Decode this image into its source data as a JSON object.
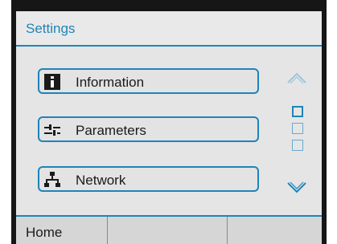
{
  "screen": {
    "title": "Settings"
  },
  "menu": {
    "items": [
      {
        "label": "Information",
        "icon": "info-icon"
      },
      {
        "label": "Parameters",
        "icon": "parameters-icon"
      },
      {
        "label": "Network",
        "icon": "network-icon"
      }
    ]
  },
  "pager": {
    "current_page": 1,
    "total_pages": 3
  },
  "softkeys": [
    {
      "label": "Home"
    },
    {
      "label": ""
    },
    {
      "label": ""
    }
  ],
  "colors": {
    "accent": "#1f84b8",
    "screen_bg": "#e5e5e5",
    "softkey_bg": "#d6d6d6",
    "bezel": "#161616"
  }
}
